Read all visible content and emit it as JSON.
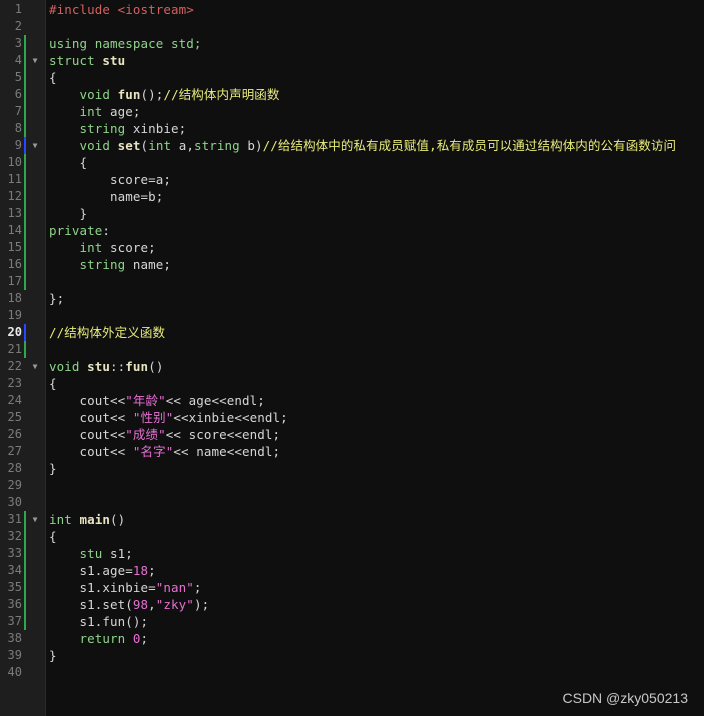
{
  "editor": {
    "lines": [
      {
        "n": "1",
        "fold": "",
        "tokens": [
          {
            "t": "#include <iostream>",
            "c": "pp"
          }
        ]
      },
      {
        "n": "2",
        "fold": "",
        "tokens": []
      },
      {
        "n": "3",
        "fold": "",
        "tokens": [
          {
            "t": "using namespace std;",
            "c": "kw"
          }
        ]
      },
      {
        "n": "4",
        "fold": "▼",
        "tokens": [
          {
            "t": "struct ",
            "c": "kw"
          },
          {
            "t": "stu",
            "c": "fn"
          }
        ]
      },
      {
        "n": "5",
        "fold": "",
        "tokens": [
          {
            "t": "{",
            "c": "plain"
          }
        ]
      },
      {
        "n": "6",
        "fold": "",
        "tokens": [
          {
            "t": "    ",
            "c": "plain"
          },
          {
            "t": "void ",
            "c": "type"
          },
          {
            "t": "fun",
            "c": "fn"
          },
          {
            "t": "();",
            "c": "plain"
          },
          {
            "t": "//结构体内声明函数",
            "c": "com"
          }
        ]
      },
      {
        "n": "7",
        "fold": "",
        "tokens": [
          {
            "t": "    ",
            "c": "plain"
          },
          {
            "t": "int ",
            "c": "type"
          },
          {
            "t": "age;",
            "c": "plain"
          }
        ]
      },
      {
        "n": "8",
        "fold": "",
        "tokens": [
          {
            "t": "    ",
            "c": "plain"
          },
          {
            "t": "string ",
            "c": "type"
          },
          {
            "t": "xinbie;",
            "c": "plain"
          }
        ]
      },
      {
        "n": "9",
        "fold": "▼",
        "tokens": [
          {
            "t": "    ",
            "c": "plain"
          },
          {
            "t": "void ",
            "c": "type"
          },
          {
            "t": "set",
            "c": "fn"
          },
          {
            "t": "(",
            "c": "plain"
          },
          {
            "t": "int ",
            "c": "type"
          },
          {
            "t": "a,",
            "c": "plain"
          },
          {
            "t": "string ",
            "c": "type"
          },
          {
            "t": "b)",
            "c": "plain"
          },
          {
            "t": "//给结构体中的私有成员赋值,私有成员可以通过结构体内的公有函数访问",
            "c": "com"
          }
        ]
      },
      {
        "n": "10",
        "fold": "",
        "tokens": [
          {
            "t": "    {",
            "c": "plain"
          }
        ]
      },
      {
        "n": "11",
        "fold": "",
        "tokens": [
          {
            "t": "        score=a;",
            "c": "plain"
          }
        ]
      },
      {
        "n": "12",
        "fold": "",
        "tokens": [
          {
            "t": "        name=b;",
            "c": "plain"
          }
        ]
      },
      {
        "n": "13",
        "fold": "",
        "tokens": [
          {
            "t": "    }",
            "c": "plain"
          }
        ]
      },
      {
        "n": "14",
        "fold": "",
        "tokens": [
          {
            "t": "private",
            "c": "kw"
          },
          {
            "t": ":",
            "c": "plain"
          }
        ]
      },
      {
        "n": "15",
        "fold": "",
        "tokens": [
          {
            "t": "    ",
            "c": "plain"
          },
          {
            "t": "int ",
            "c": "type"
          },
          {
            "t": "score;",
            "c": "plain"
          }
        ]
      },
      {
        "n": "16",
        "fold": "",
        "tokens": [
          {
            "t": "    ",
            "c": "plain"
          },
          {
            "t": "string ",
            "c": "type"
          },
          {
            "t": "name;",
            "c": "plain"
          }
        ]
      },
      {
        "n": "17",
        "fold": "",
        "tokens": []
      },
      {
        "n": "18",
        "fold": "",
        "tokens": [
          {
            "t": "};",
            "c": "plain"
          }
        ]
      },
      {
        "n": "19",
        "fold": "",
        "tokens": []
      },
      {
        "n": "20",
        "fold": "",
        "current": true,
        "tokens": [
          {
            "t": "//结构体外定义函数",
            "c": "com"
          }
        ]
      },
      {
        "n": "21",
        "fold": "",
        "tokens": []
      },
      {
        "n": "22",
        "fold": "▼",
        "tokens": [
          {
            "t": "void ",
            "c": "type"
          },
          {
            "t": "stu",
            "c": "fn"
          },
          {
            "t": "::",
            "c": "plain"
          },
          {
            "t": "fun",
            "c": "fn"
          },
          {
            "t": "()",
            "c": "plain"
          }
        ]
      },
      {
        "n": "23",
        "fold": "",
        "tokens": [
          {
            "t": "{",
            "c": "plain"
          }
        ]
      },
      {
        "n": "24",
        "fold": "",
        "tokens": [
          {
            "t": "    cout<<",
            "c": "plain"
          },
          {
            "t": "\"年龄\"",
            "c": "str"
          },
          {
            "t": "<< age<<endl;",
            "c": "plain"
          }
        ]
      },
      {
        "n": "25",
        "fold": "",
        "tokens": [
          {
            "t": "    cout<< ",
            "c": "plain"
          },
          {
            "t": "\"性别\"",
            "c": "str"
          },
          {
            "t": "<<xinbie<<endl;",
            "c": "plain"
          }
        ]
      },
      {
        "n": "26",
        "fold": "",
        "tokens": [
          {
            "t": "    cout<<",
            "c": "plain"
          },
          {
            "t": "\"成绩\"",
            "c": "str"
          },
          {
            "t": "<< score<<endl;",
            "c": "plain"
          }
        ]
      },
      {
        "n": "27",
        "fold": "",
        "tokens": [
          {
            "t": "    cout<< ",
            "c": "plain"
          },
          {
            "t": "\"名字\"",
            "c": "str"
          },
          {
            "t": "<< name<<endl;",
            "c": "plain"
          }
        ]
      },
      {
        "n": "28",
        "fold": "",
        "tokens": [
          {
            "t": "}",
            "c": "plain"
          }
        ]
      },
      {
        "n": "29",
        "fold": "",
        "tokens": []
      },
      {
        "n": "30",
        "fold": "",
        "tokens": []
      },
      {
        "n": "31",
        "fold": "▼",
        "tokens": [
          {
            "t": "int ",
            "c": "type"
          },
          {
            "t": "main",
            "c": "fn"
          },
          {
            "t": "()",
            "c": "plain"
          }
        ]
      },
      {
        "n": "32",
        "fold": "",
        "tokens": [
          {
            "t": "{",
            "c": "plain"
          }
        ]
      },
      {
        "n": "33",
        "fold": "",
        "tokens": [
          {
            "t": "    ",
            "c": "plain"
          },
          {
            "t": "stu ",
            "c": "type"
          },
          {
            "t": "s1;",
            "c": "plain"
          }
        ]
      },
      {
        "n": "34",
        "fold": "",
        "tokens": [
          {
            "t": "    s1.age=",
            "c": "plain"
          },
          {
            "t": "18",
            "c": "num"
          },
          {
            "t": ";",
            "c": "plain"
          }
        ]
      },
      {
        "n": "35",
        "fold": "",
        "tokens": [
          {
            "t": "    s1.xinbie=",
            "c": "plain"
          },
          {
            "t": "\"nan\"",
            "c": "str"
          },
          {
            "t": ";",
            "c": "plain"
          }
        ]
      },
      {
        "n": "36",
        "fold": "",
        "tokens": [
          {
            "t": "    s1.set(",
            "c": "plain"
          },
          {
            "t": "98",
            "c": "num"
          },
          {
            "t": ",",
            "c": "plain"
          },
          {
            "t": "\"zky\"",
            "c": "str"
          },
          {
            "t": ");",
            "c": "plain"
          }
        ]
      },
      {
        "n": "37",
        "fold": "",
        "tokens": [
          {
            "t": "    s1.fun();",
            "c": "plain"
          }
        ]
      },
      {
        "n": "38",
        "fold": "",
        "tokens": [
          {
            "t": "    ",
            "c": "plain"
          },
          {
            "t": "return ",
            "c": "kw"
          },
          {
            "t": "0",
            "c": "num"
          },
          {
            "t": ";",
            "c": "plain"
          }
        ]
      },
      {
        "n": "39",
        "fold": "",
        "tokens": [
          {
            "t": "}",
            "c": "plain"
          }
        ]
      },
      {
        "n": "40",
        "fold": "",
        "tokens": []
      }
    ],
    "change_marks": [
      {
        "from": 3,
        "to": 8,
        "color": "#2fa84a"
      },
      {
        "from": 9,
        "to": 9,
        "color": "#2b46ff"
      },
      {
        "from": 10,
        "to": 17,
        "color": "#2fa84a"
      },
      {
        "from": 20,
        "to": 20,
        "color": "#2b46ff"
      },
      {
        "from": 21,
        "to": 21,
        "color": "#2fa84a"
      },
      {
        "from": 31,
        "to": 37,
        "color": "#2fa84a"
      }
    ]
  },
  "watermark": "CSDN @zky050213"
}
